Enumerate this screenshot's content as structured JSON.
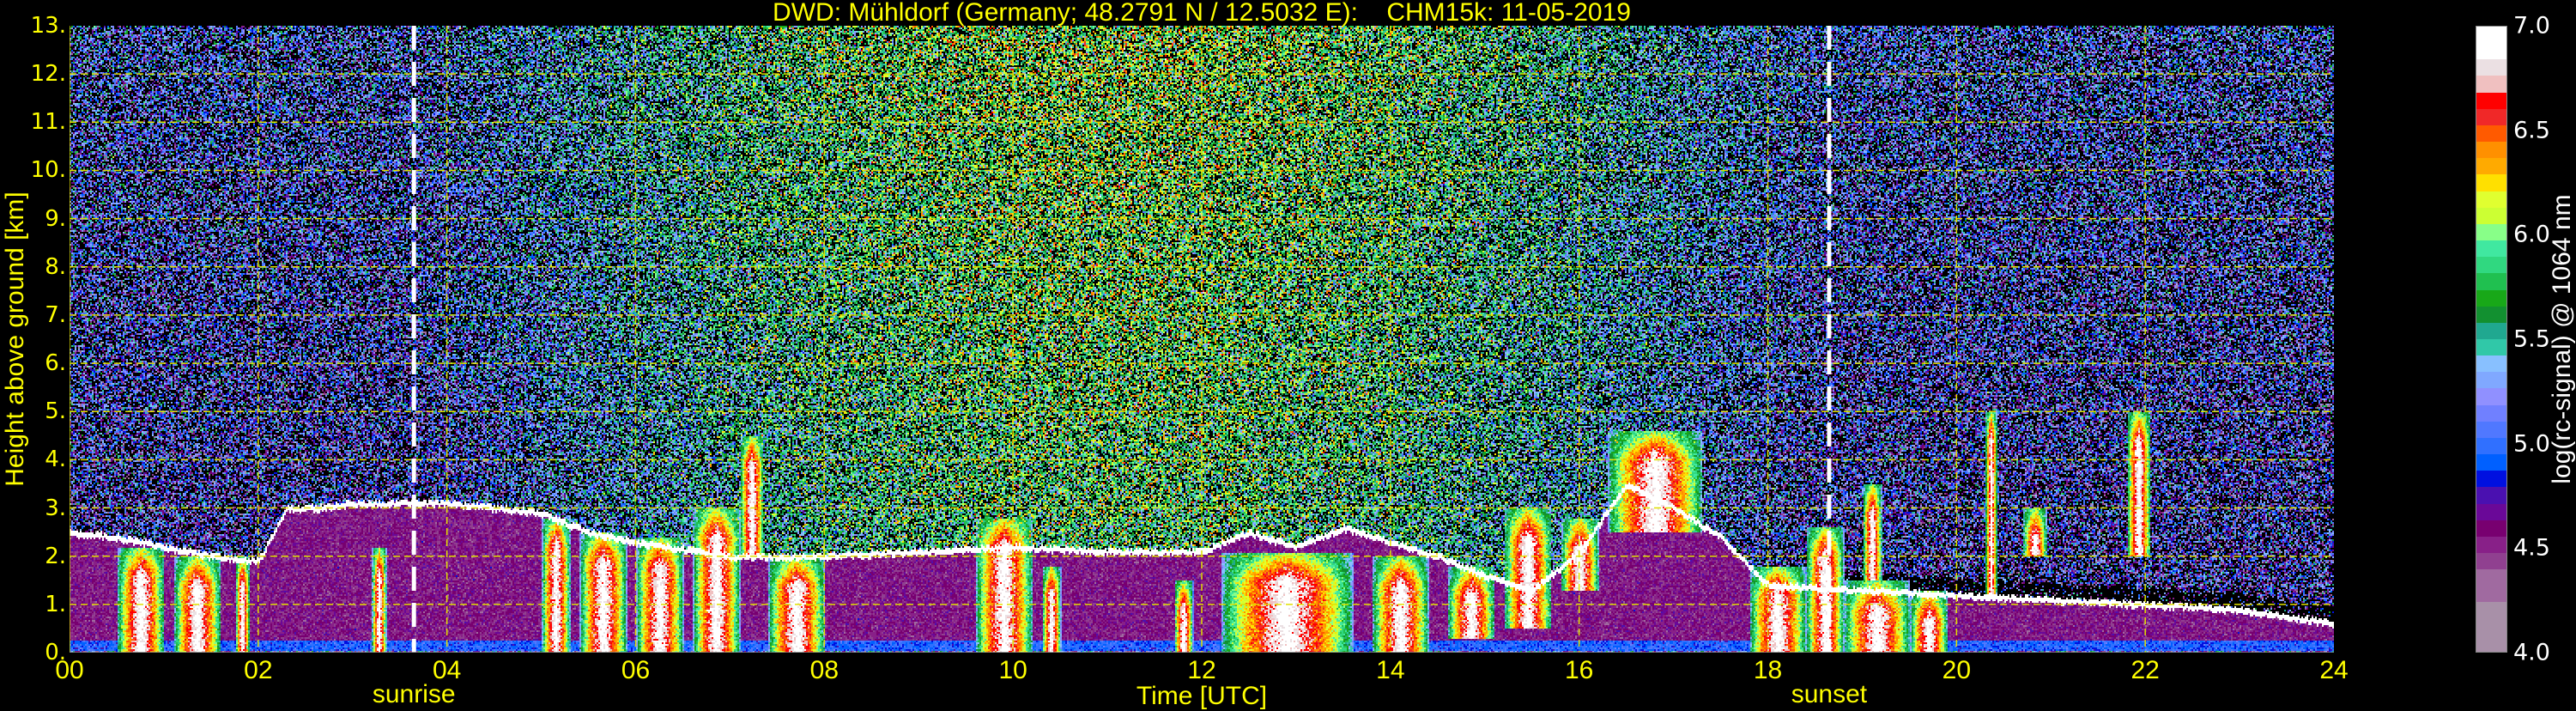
{
  "chart_data": {
    "type": "heatmap",
    "title": "DWD: Mühldorf (Germany; 48.2791 N / 12.5032 E):    CHM15k: 11-05-2019",
    "xlabel": "Time [UTC]",
    "ylabel": "Height above ground [km]",
    "xlim": [
      0,
      24
    ],
    "ylim": [
      0,
      13
    ],
    "x_ticks": [
      "00",
      "02",
      "04",
      "06",
      "08",
      "10",
      "12",
      "14",
      "16",
      "18",
      "20",
      "22",
      "24"
    ],
    "y_ticks": [
      "0.",
      "1.",
      "2.",
      "3.",
      "4.",
      "5.",
      "6.",
      "7.",
      "8.",
      "9.",
      "10.",
      "11.",
      "12.",
      "13."
    ],
    "grid": true,
    "events": [
      {
        "label": "sunrise",
        "time": 3.65
      },
      {
        "label": "sunset",
        "time": 18.65
      }
    ],
    "colorbar": {
      "label": "log(rc-signal) @ 1064 nm",
      "range": [
        4.0,
        7.0
      ],
      "ticks": [
        "4.0",
        "4.5",
        "5.0",
        "5.5",
        "6.0",
        "6.5",
        "7.0"
      ],
      "colors_top_to_bottom": [
        "#ffffff",
        "#ffffff",
        "#ebe0e3",
        "#f0c0c0",
        "#ff0000",
        "#f02828",
        "#ff5a00",
        "#ff9000",
        "#ffaa00",
        "#ffe000",
        "#e0ff30",
        "#ccff33",
        "#88ff88",
        "#40e8a0",
        "#30d880",
        "#20c050",
        "#18a818",
        "#129030",
        "#20a890",
        "#30c8a8",
        "#88c0ff",
        "#80a8ff",
        "#9090ff",
        "#7080ff",
        "#5078ff",
        "#3070ff",
        "#0060ff",
        "#0010e0",
        "#4a10b0",
        "#6a0898",
        "#780070",
        "#882088",
        "#904090",
        "#a06aa0",
        "#a06aa0",
        "#a890a8",
        "#a890a8",
        "#a890a8"
      ]
    },
    "boundary_layer_top_km": {
      "time_h": [
        0,
        0.5,
        1.0,
        1.5,
        2.0,
        2.3,
        2.6,
        3.0,
        4.0,
        5.0,
        5.5,
        6.0,
        7.0,
        8.0,
        9.0,
        10.0,
        11.0,
        12.0,
        12.5,
        13.0,
        13.5,
        14.0,
        14.5,
        15.0,
        15.5,
        16.0,
        16.5,
        17.0,
        17.5,
        17.8,
        18.0,
        19.0,
        20.0,
        21.0,
        22.0,
        23.0,
        24.0
      ],
      "height_km": [
        2.5,
        2.4,
        2.2,
        2.0,
        1.9,
        3.0,
        3.0,
        3.1,
        3.1,
        2.9,
        2.5,
        2.3,
        2.0,
        2.0,
        2.1,
        2.2,
        2.1,
        2.1,
        2.5,
        2.2,
        2.6,
        2.3,
        2.0,
        1.6,
        1.3,
        2.1,
        3.5,
        3.0,
        2.4,
        1.8,
        1.4,
        1.3,
        1.2,
        1.1,
        1.0,
        0.9,
        0.6
      ]
    },
    "clouds": [
      {
        "t0": 0.5,
        "t1": 1.0,
        "base_km": 0,
        "top_km": 2.2
      },
      {
        "t0": 1.1,
        "t1": 1.6,
        "base_km": 0,
        "top_km": 2.0
      },
      {
        "t0": 1.75,
        "t1": 1.9,
        "base_km": 0,
        "top_km": 2.0
      },
      {
        "t0": 3.2,
        "t1": 3.35,
        "base_km": 0,
        "top_km": 2.2
      },
      {
        "t0": 5.0,
        "t1": 5.3,
        "base_km": 0,
        "top_km": 2.8
      },
      {
        "t0": 5.4,
        "t1": 5.9,
        "base_km": 0,
        "top_km": 2.5
      },
      {
        "t0": 6.0,
        "t1": 6.5,
        "base_km": 0,
        "top_km": 2.4
      },
      {
        "t0": 6.6,
        "t1": 7.1,
        "base_km": 0,
        "top_km": 3.0
      },
      {
        "t0": 7.1,
        "t1": 7.35,
        "base_km": 2.0,
        "top_km": 4.5
      },
      {
        "t0": 7.4,
        "t1": 8.0,
        "base_km": 0,
        "top_km": 2.0
      },
      {
        "t0": 9.6,
        "t1": 10.2,
        "base_km": 0,
        "top_km": 2.8
      },
      {
        "t0": 10.3,
        "t1": 10.5,
        "base_km": 0,
        "top_km": 1.8
      },
      {
        "t0": 11.7,
        "t1": 11.9,
        "base_km": 0,
        "top_km": 1.5
      },
      {
        "t0": 12.2,
        "t1": 13.6,
        "base_km": 0,
        "top_km": 2.1
      },
      {
        "t0": 13.8,
        "t1": 14.4,
        "base_km": 0,
        "top_km": 2.0
      },
      {
        "t0": 14.6,
        "t1": 15.1,
        "base_km": 0.3,
        "top_km": 1.8
      },
      {
        "t0": 15.2,
        "t1": 15.7,
        "base_km": 0.5,
        "top_km": 3.0
      },
      {
        "t0": 15.8,
        "t1": 16.2,
        "base_km": 1.3,
        "top_km": 2.8
      },
      {
        "t0": 16.3,
        "t1": 17.3,
        "base_km": 2.5,
        "top_km": 4.6
      },
      {
        "t0": 17.8,
        "t1": 18.4,
        "base_km": 0,
        "top_km": 1.8
      },
      {
        "t0": 18.4,
        "t1": 18.8,
        "base_km": 0,
        "top_km": 2.6
      },
      {
        "t0": 18.8,
        "t1": 19.5,
        "base_km": 0,
        "top_km": 1.5
      },
      {
        "t0": 19.0,
        "t1": 19.2,
        "base_km": 1.5,
        "top_km": 3.5
      },
      {
        "t0": 19.5,
        "t1": 19.9,
        "base_km": 0,
        "top_km": 1.3
      },
      {
        "t0": 20.3,
        "t1": 20.42,
        "base_km": 1.2,
        "top_km": 5.0
      },
      {
        "t0": 20.7,
        "t1": 20.95,
        "base_km": 2.0,
        "top_km": 3.0
      },
      {
        "t0": 21.8,
        "t1": 22.05,
        "base_km": 2.0,
        "top_km": 5.0
      }
    ]
  }
}
